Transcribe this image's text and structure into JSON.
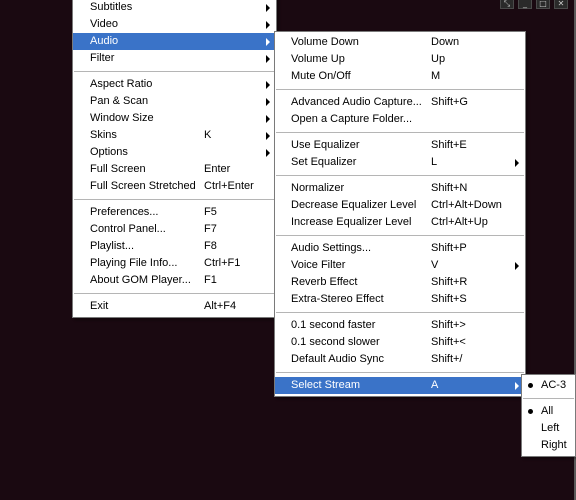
{
  "colors": {
    "video_bg": "#1a0911",
    "menu_bg": "#ffffff",
    "highlight": "#3a73c8"
  },
  "window_controls": {
    "restore_glyph": "⤡",
    "minimize_glyph": "_",
    "maximize_glyph": "□",
    "close_glyph": "✕"
  },
  "main_menu": {
    "items": [
      {
        "label": "Subtitles",
        "shortcut": "",
        "submenu": true
      },
      {
        "label": "Video",
        "shortcut": "",
        "submenu": true
      },
      {
        "label": "Audio",
        "shortcut": "",
        "submenu": true
      },
      {
        "label": "Filter",
        "shortcut": "",
        "submenu": true
      },
      {
        "label": "Aspect Ratio",
        "shortcut": "",
        "submenu": true
      },
      {
        "label": "Pan & Scan",
        "shortcut": "",
        "submenu": true
      },
      {
        "label": "Window Size",
        "shortcut": "",
        "submenu": true
      },
      {
        "label": "Skins",
        "shortcut": "K",
        "submenu": true
      },
      {
        "label": "Options",
        "shortcut": "",
        "submenu": true
      },
      {
        "label": "Full Screen",
        "shortcut": "Enter",
        "submenu": false
      },
      {
        "label": "Full Screen Stretched",
        "shortcut": "Ctrl+Enter",
        "submenu": false
      },
      {
        "label": "Preferences...",
        "shortcut": "F5",
        "submenu": false
      },
      {
        "label": "Control Panel...",
        "shortcut": "F7",
        "submenu": false
      },
      {
        "label": "Playlist...",
        "shortcut": "F8",
        "submenu": false
      },
      {
        "label": "Playing File Info...",
        "shortcut": "Ctrl+F1",
        "submenu": false
      },
      {
        "label": "About GOM Player...",
        "shortcut": "F1",
        "submenu": false
      },
      {
        "label": "Exit",
        "shortcut": "Alt+F4",
        "submenu": false
      }
    ]
  },
  "audio_menu": {
    "items": [
      {
        "label": "Volume Down",
        "shortcut": "Down"
      },
      {
        "label": "Volume Up",
        "shortcut": "Up"
      },
      {
        "label": "Mute On/Off",
        "shortcut": "M"
      },
      {
        "label": "Advanced Audio Capture...",
        "shortcut": "Shift+G"
      },
      {
        "label": "Open a Capture Folder...",
        "shortcut": ""
      },
      {
        "label": "Use Equalizer",
        "shortcut": "Shift+E"
      },
      {
        "label": "Set Equalizer",
        "shortcut": "L"
      },
      {
        "label": "Normalizer",
        "shortcut": "Shift+N"
      },
      {
        "label": "Decrease Equalizer Level",
        "shortcut": "Ctrl+Alt+Down"
      },
      {
        "label": "Increase Equalizer Level",
        "shortcut": "Ctrl+Alt+Up"
      },
      {
        "label": "Audio Settings...",
        "shortcut": "Shift+P"
      },
      {
        "label": "Voice Filter",
        "shortcut": "V"
      },
      {
        "label": "Reverb Effect",
        "shortcut": "Shift+R"
      },
      {
        "label": "Extra-Stereo Effect",
        "shortcut": "Shift+S"
      },
      {
        "label": "0.1 second faster",
        "shortcut": "Shift+>"
      },
      {
        "label": "0.1 second slower",
        "shortcut": "Shift+<"
      },
      {
        "label": "Default Audio Sync",
        "shortcut": "Shift+/"
      },
      {
        "label": "Select Stream",
        "shortcut": "A"
      }
    ]
  },
  "stream_menu": {
    "items": [
      {
        "label": "AC-3",
        "checked": true
      },
      {
        "label": "All",
        "checked": true
      },
      {
        "label": "Left",
        "checked": false
      },
      {
        "label": "Right",
        "checked": false
      }
    ]
  }
}
